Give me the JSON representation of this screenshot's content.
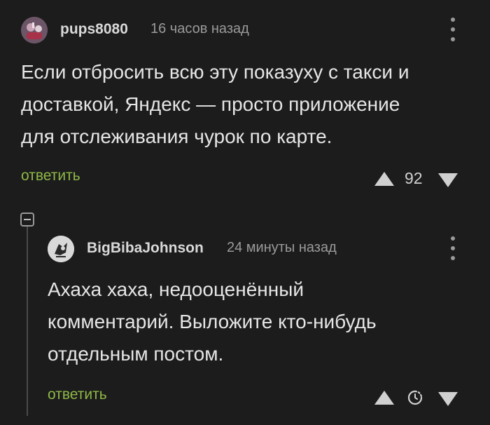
{
  "comments": [
    {
      "username": "pups8080",
      "time": "16 часов назад",
      "text_lines": [
        "Если отбросить всю эту показуху с такси и",
        "доставкой, Яндекс — просто приложение",
        "для отслеживания чурок по карте."
      ],
      "reply_label": "ответить",
      "score": "92"
    },
    {
      "username": "BigBibaJohnson",
      "time": "24 минуты назад",
      "text_lines": [
        "Ахаха хаха, недооценённый",
        "комментарий. Выложите кто-нибудь",
        "отдельным постом."
      ],
      "reply_label": "ответить",
      "score_icon": "timer-icon"
    }
  ],
  "colors": {
    "background": "#1c1c1c",
    "reply_link": "#8fb847",
    "text": "#e6e6e6",
    "muted": "#9a9a9a"
  }
}
